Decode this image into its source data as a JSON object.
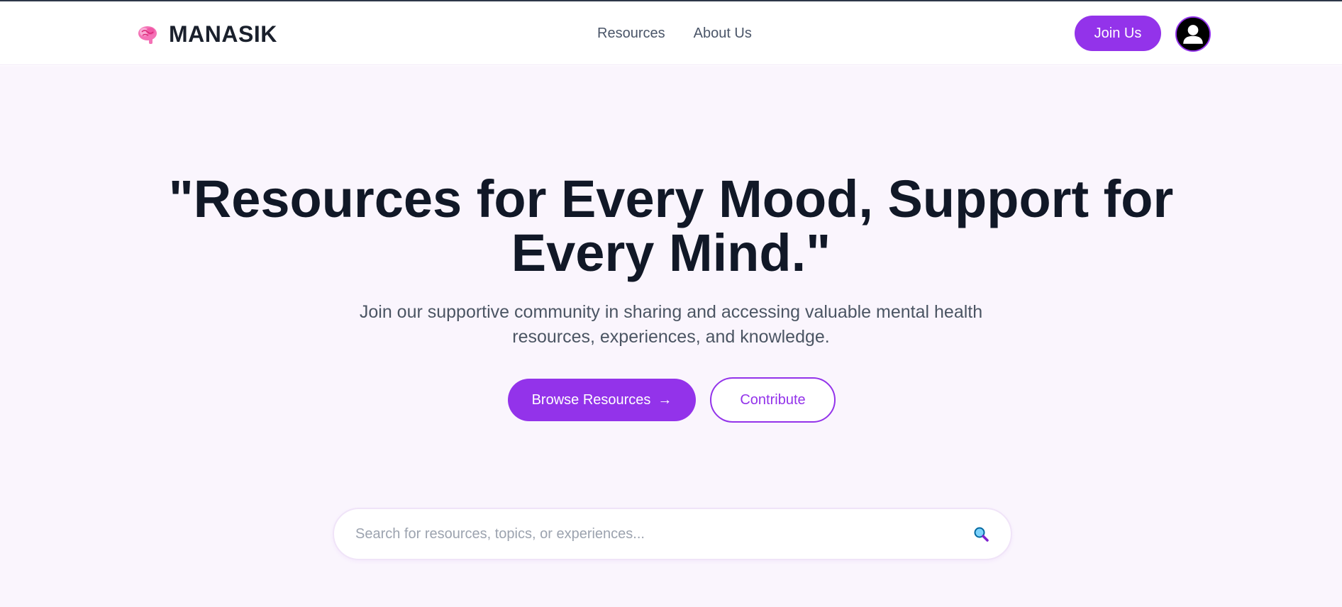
{
  "brand": {
    "name": "MANASIK",
    "icon": "brain-icon",
    "accent": "#9333ea"
  },
  "nav": {
    "items": [
      {
        "label": "Resources"
      },
      {
        "label": "About Us"
      }
    ],
    "join_label": "Join Us"
  },
  "hero": {
    "title": "\"Resources for Every Mood, Support for Every Mind.\"",
    "subtitle": "Join our supportive community in sharing and accessing valuable mental health resources, experiences, and knowledge.",
    "browse_label": "Browse Resources",
    "browse_arrow": "→",
    "contribute_label": "Contribute"
  },
  "search": {
    "placeholder": "Search for resources, topics, or experiences...",
    "icon": "magnifier-icon"
  }
}
